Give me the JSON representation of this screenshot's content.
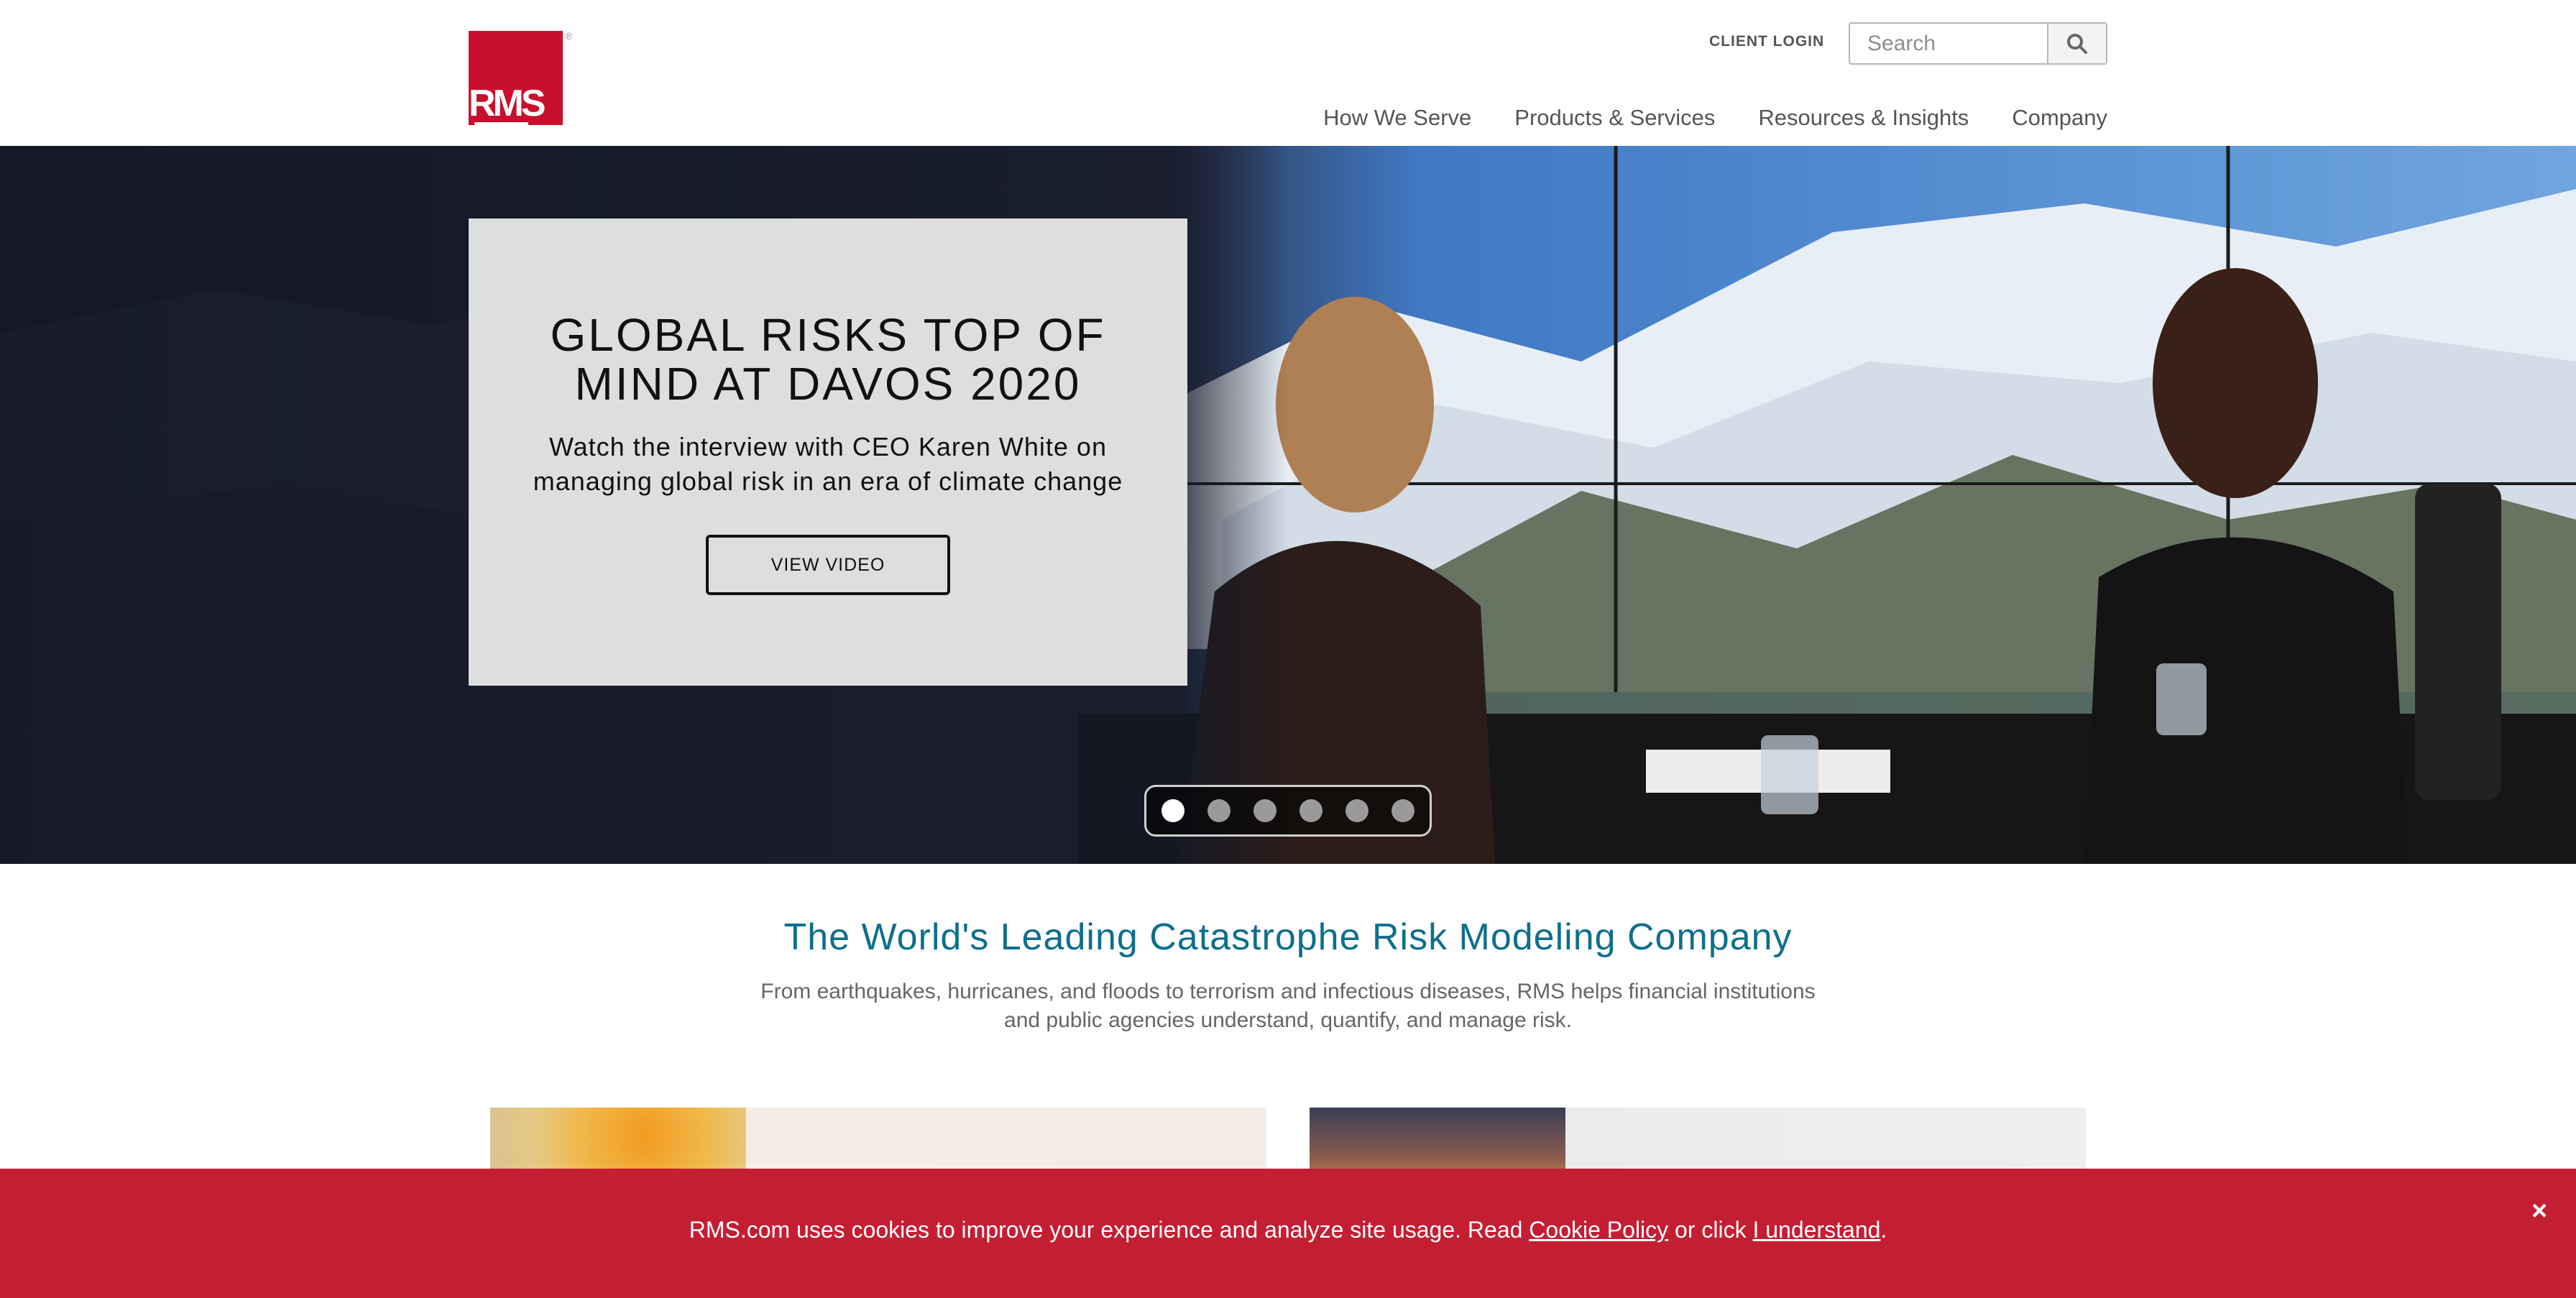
{
  "brand": {
    "logo_text": "RMS",
    "logo_reg": "®",
    "accent": "#c8102e",
    "link_color": "#0e6f8c"
  },
  "header": {
    "client_login": "CLIENT LOGIN",
    "search_placeholder": "Search",
    "search_icon": "search-icon"
  },
  "nav": {
    "items": [
      {
        "label": "How We Serve"
      },
      {
        "label": "Products & Services"
      },
      {
        "label": "Resources & Insights"
      },
      {
        "label": "Company"
      }
    ]
  },
  "hero": {
    "title_line1": "GLOBAL RISKS TOP OF",
    "title_line2": "MIND AT DAVOS 2020",
    "subtitle_line1": "Watch the interview with CEO Karen White on",
    "subtitle_line2": "managing global risk in an era of climate change",
    "button_label": "VIEW VIDEO",
    "slide_count": 6,
    "active_slide": 1
  },
  "intro": {
    "title": "The World's Leading Catastrophe Risk Modeling Company",
    "text_line1": "From earthquakes, hurricanes, and floods to terrorism and infectious diseases, RMS helps financial institutions",
    "text_line2": "and public agencies understand, quantify, and manage risk."
  },
  "cookie": {
    "text_before": "RMS.com uses cookies to improve your experience and analyze site usage. Read ",
    "policy_link": "Cookie Policy",
    "text_middle": " or click ",
    "accept_link": "I understand",
    "text_after": ".",
    "close_symbol": "×"
  }
}
